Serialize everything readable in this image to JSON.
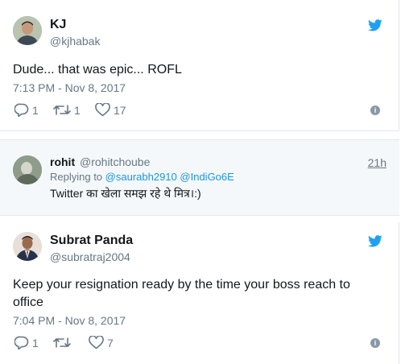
{
  "tweets": [
    {
      "name": "KJ",
      "handle": "@kjhabak",
      "text": "Dude... that was epic... ROFL",
      "time": "7:13 PM - Nov 8, 2017",
      "replies": "1",
      "retweets": "1",
      "likes": "17"
    },
    {
      "name": "Subrat Panda",
      "handle": "@subratraj2004",
      "text_line1": "Keep your resignation ready by the time your boss reach to",
      "text_line2": "office",
      "time": "7:04 PM - Nov 8, 2017",
      "replies": "1",
      "likes": "7"
    }
  ],
  "reply": {
    "name": "rohit",
    "handle": "@rohitchoube",
    "time": "21h",
    "replying_prefix": "Replying to",
    "mention1": "@saurabh2910",
    "mention2": "@IndiGo6E",
    "text": "Twitter का खेला समझ रहे थे मित्र।:)"
  },
  "colors": {
    "twitter_blue": "#1da1f2",
    "secondary_text": "#657786",
    "link_blue": "#1b95e0"
  }
}
